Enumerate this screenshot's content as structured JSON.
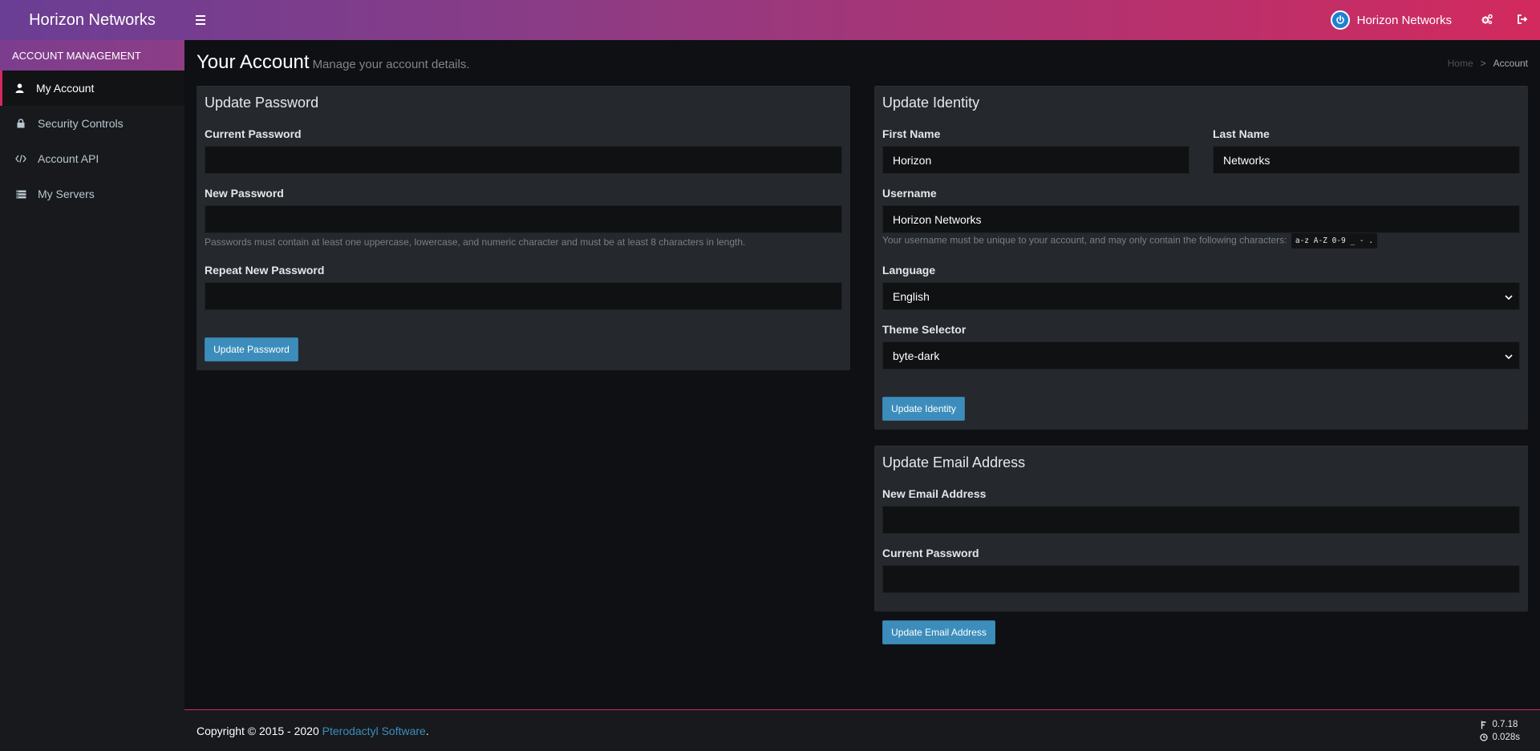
{
  "app": {
    "brand": "Horizon Networks",
    "user_name": "Horizon Networks"
  },
  "sidebar": {
    "header": "ACCOUNT MANAGEMENT",
    "items": [
      {
        "label": "My Account",
        "icon": "user-icon",
        "active": true
      },
      {
        "label": "Security Controls",
        "icon": "lock-icon",
        "active": false
      },
      {
        "label": "Account API",
        "icon": "code-icon",
        "active": false
      },
      {
        "label": "My Servers",
        "icon": "server-icon",
        "active": false
      }
    ]
  },
  "page": {
    "title": "Your Account",
    "subtitle": "Manage your account details.",
    "breadcrumb": {
      "home": "Home",
      "separator": ">",
      "current": "Account"
    }
  },
  "password_box": {
    "title": "Update Password",
    "current_label": "Current Password",
    "current_value": "",
    "new_label": "New Password",
    "new_value": "",
    "new_help": "Passwords must contain at least one uppercase, lowercase, and numeric character and must be at least 8 characters in length.",
    "repeat_label": "Repeat New Password",
    "repeat_value": "",
    "submit_label": "Update Password"
  },
  "identity_box": {
    "title": "Update Identity",
    "first_name_label": "First Name",
    "first_name_value": "Horizon",
    "last_name_label": "Last Name",
    "last_name_value": "Networks",
    "username_label": "Username",
    "username_value": "Horizon Networks",
    "username_help": "Your username must be unique to your account, and may only contain the following characters:",
    "username_chars": "a-z A-Z 0-9 _ - .",
    "language_label": "Language",
    "language_value": "English",
    "theme_label": "Theme Selector",
    "theme_value": "byte-dark",
    "submit_label": "Update Identity"
  },
  "email_box": {
    "title": "Update Email Address",
    "email_label": "New Email Address",
    "email_value": "",
    "password_label": "Current Password",
    "password_value": "",
    "submit_label": "Update Email Address"
  },
  "footer": {
    "copyright_prefix": "Copyright © 2015 - 2020 ",
    "copyright_link": "Pterodactyl Software",
    "copyright_suffix": ".",
    "version": "0.7.18",
    "render_time": "0.028s"
  },
  "colors": {
    "accent": "#d22a5e",
    "primary_button": "#3c8dbc",
    "header_gradient_start": "#6a3e94",
    "header_gradient_end": "#d22a5e"
  }
}
